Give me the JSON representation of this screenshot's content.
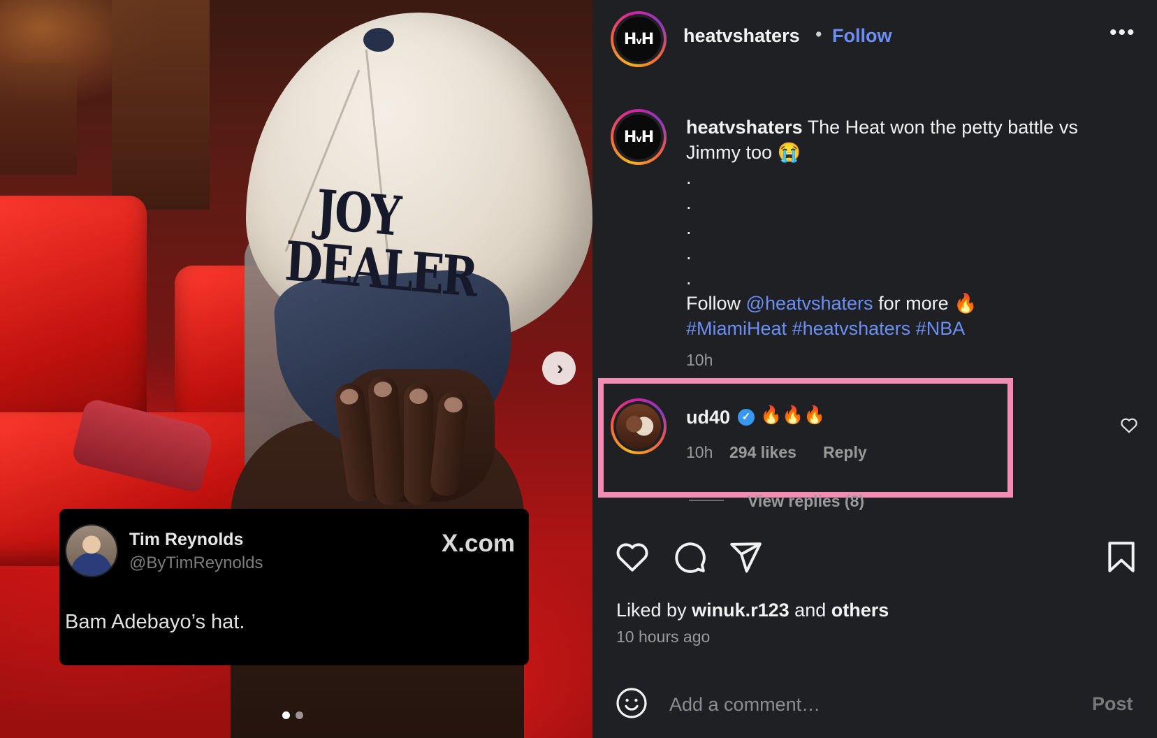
{
  "post": {
    "username": "heatvshaters",
    "avatar_text": "HvH",
    "header_separator": "•",
    "follow_label": "Follow",
    "more_icon": "more-horizontal-icon",
    "caption_username": "heatvshaters",
    "caption_text": "The Heat won the petty battle vs Jimmy too 😭",
    "caption_dot": ".",
    "caption_follow_prefix": "Follow",
    "caption_mention": "@heatvshaters",
    "caption_follow_suffix": "for more 🔥",
    "hashtags": [
      "#MiamiHeat",
      "#heatvshaters",
      "#NBA"
    ],
    "caption_time": "10h",
    "liked_by_prefix": "Liked by",
    "liked_by_user": "winuk.r123",
    "liked_by_and": "and",
    "liked_by_others": "others",
    "post_time": "10 hours ago"
  },
  "media": {
    "cap_text": "JOY DEALER",
    "carousel_index": 1,
    "carousel_count": 2,
    "tweet": {
      "name": "Tim Reynolds",
      "handle": "@ByTimReynolds",
      "site": "X.com",
      "text": "Bam Adebayo’s hat."
    }
  },
  "comment": {
    "username": "ud40",
    "verified": true,
    "text": "🔥🔥🔥",
    "time": "10h",
    "likes": "294 likes",
    "reply_label": "Reply",
    "view_replies": "View replies (8)",
    "highlight_color": "#f28cb3"
  },
  "composer": {
    "placeholder": "Add a comment…",
    "post_label": "Post"
  },
  "colors": {
    "background": "#1f2024",
    "link": "#6b8ff7",
    "muted": "#9a9a9a"
  }
}
